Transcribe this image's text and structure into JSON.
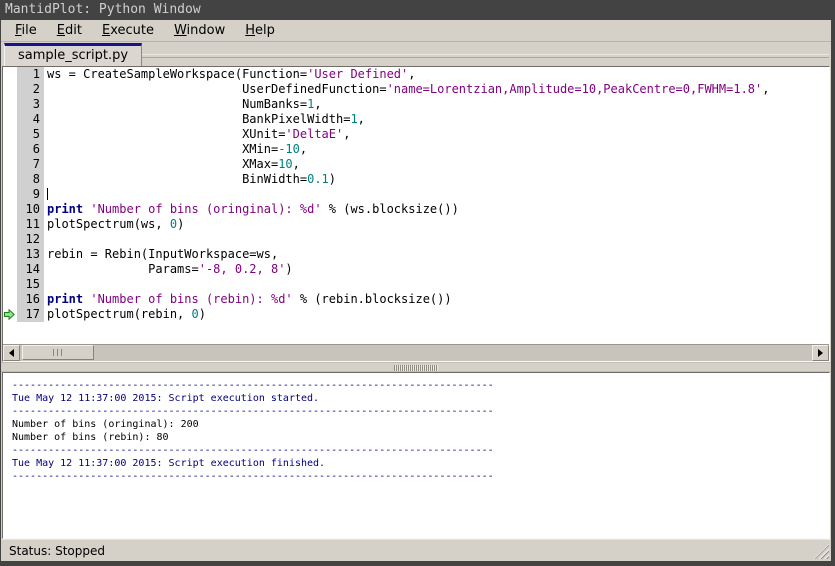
{
  "window": {
    "title": "MantidPlot: Python Window",
    "status": "Status: Stopped"
  },
  "menu": {
    "items": [
      "File",
      "Edit",
      "Execute",
      "Window",
      "Help"
    ]
  },
  "tab": {
    "label": "sample_script.py"
  },
  "colors": {
    "title_bg": "#434343",
    "chrome_bg": "#d5d1c9",
    "tab_accent": "#14148c",
    "keyword": "#00007f",
    "string": "#7f007f",
    "number": "#007f7f",
    "log_text": "#000080",
    "marker_green": "#8de48d"
  },
  "editor": {
    "lines": [
      {
        "num": "1",
        "marker": false,
        "caret": false,
        "segments": [
          [
            "d",
            "ws = CreateSampleWorkspace(Function="
          ],
          [
            "s",
            "'User Defined'"
          ],
          [
            "d",
            ","
          ]
        ]
      },
      {
        "num": "2",
        "marker": false,
        "caret": false,
        "segments": [
          [
            "d",
            "                           UserDefinedFunction="
          ],
          [
            "s",
            "'name=Lorentzian,Amplitude=10,PeakCentre=0,FWHM=1.8'"
          ],
          [
            "d",
            ","
          ]
        ]
      },
      {
        "num": "3",
        "marker": false,
        "caret": false,
        "segments": [
          [
            "d",
            "                           NumBanks="
          ],
          [
            "n",
            "1"
          ],
          [
            "d",
            ","
          ]
        ]
      },
      {
        "num": "4",
        "marker": false,
        "caret": false,
        "segments": [
          [
            "d",
            "                           BankPixelWidth="
          ],
          [
            "n",
            "1"
          ],
          [
            "d",
            ","
          ]
        ]
      },
      {
        "num": "5",
        "marker": false,
        "caret": false,
        "segments": [
          [
            "d",
            "                           XUnit="
          ],
          [
            "s",
            "'DeltaE'"
          ],
          [
            "d",
            ","
          ]
        ]
      },
      {
        "num": "6",
        "marker": false,
        "caret": false,
        "segments": [
          [
            "d",
            "                           XMin="
          ],
          [
            "n",
            "-10"
          ],
          [
            "d",
            ","
          ]
        ]
      },
      {
        "num": "7",
        "marker": false,
        "caret": false,
        "segments": [
          [
            "d",
            "                           XMax="
          ],
          [
            "n",
            "10"
          ],
          [
            "d",
            ","
          ]
        ]
      },
      {
        "num": "8",
        "marker": false,
        "caret": false,
        "segments": [
          [
            "d",
            "                           BinWidth="
          ],
          [
            "n",
            "0.1"
          ],
          [
            "d",
            ")"
          ]
        ]
      },
      {
        "num": "9",
        "marker": false,
        "caret": true,
        "segments": []
      },
      {
        "num": "10",
        "marker": false,
        "caret": false,
        "segments": [
          [
            "k",
            "print"
          ],
          [
            "d",
            " "
          ],
          [
            "s",
            "'Number of bins (oringinal): %d'"
          ],
          [
            "d",
            " % (ws.blocksize())"
          ]
        ]
      },
      {
        "num": "11",
        "marker": false,
        "caret": false,
        "segments": [
          [
            "d",
            "plotSpectrum(ws, "
          ],
          [
            "n",
            "0"
          ],
          [
            "d",
            ")"
          ]
        ]
      },
      {
        "num": "12",
        "marker": false,
        "caret": false,
        "segments": []
      },
      {
        "num": "13",
        "marker": false,
        "caret": false,
        "segments": [
          [
            "d",
            "rebin = Rebin(InputWorkspace=ws,"
          ]
        ]
      },
      {
        "num": "14",
        "marker": false,
        "caret": false,
        "segments": [
          [
            "d",
            "              Params="
          ],
          [
            "s",
            "'-8, 0.2, 8'"
          ],
          [
            "d",
            ")"
          ]
        ]
      },
      {
        "num": "15",
        "marker": false,
        "caret": false,
        "segments": []
      },
      {
        "num": "16",
        "marker": false,
        "caret": false,
        "segments": [
          [
            "k",
            "print"
          ],
          [
            "d",
            " "
          ],
          [
            "s",
            "'Number of bins (rebin): %d'"
          ],
          [
            "d",
            " % (rebin.blocksize())"
          ]
        ]
      },
      {
        "num": "17",
        "marker": true,
        "caret": false,
        "segments": [
          [
            "d",
            "plotSpectrum(rebin, "
          ],
          [
            "n",
            "0"
          ],
          [
            "d",
            ")"
          ]
        ]
      }
    ]
  },
  "output": {
    "lines": [
      {
        "type": "rule",
        "text": "--------------------------------------------------------------------------------"
      },
      {
        "type": "log",
        "text": "Tue May 12 11:37:00 2015: Script execution started."
      },
      {
        "type": "rule",
        "text": "--------------------------------------------------------------------------------"
      },
      {
        "type": "print",
        "text": "Number of bins (oringinal): 200"
      },
      {
        "type": "print",
        "text": "Number of bins (rebin): 80"
      },
      {
        "type": "rule",
        "text": "--------------------------------------------------------------------------------"
      },
      {
        "type": "log",
        "text": "Tue May 12 11:37:00 2015: Script execution finished."
      },
      {
        "type": "rule",
        "text": "--------------------------------------------------------------------------------"
      }
    ]
  }
}
